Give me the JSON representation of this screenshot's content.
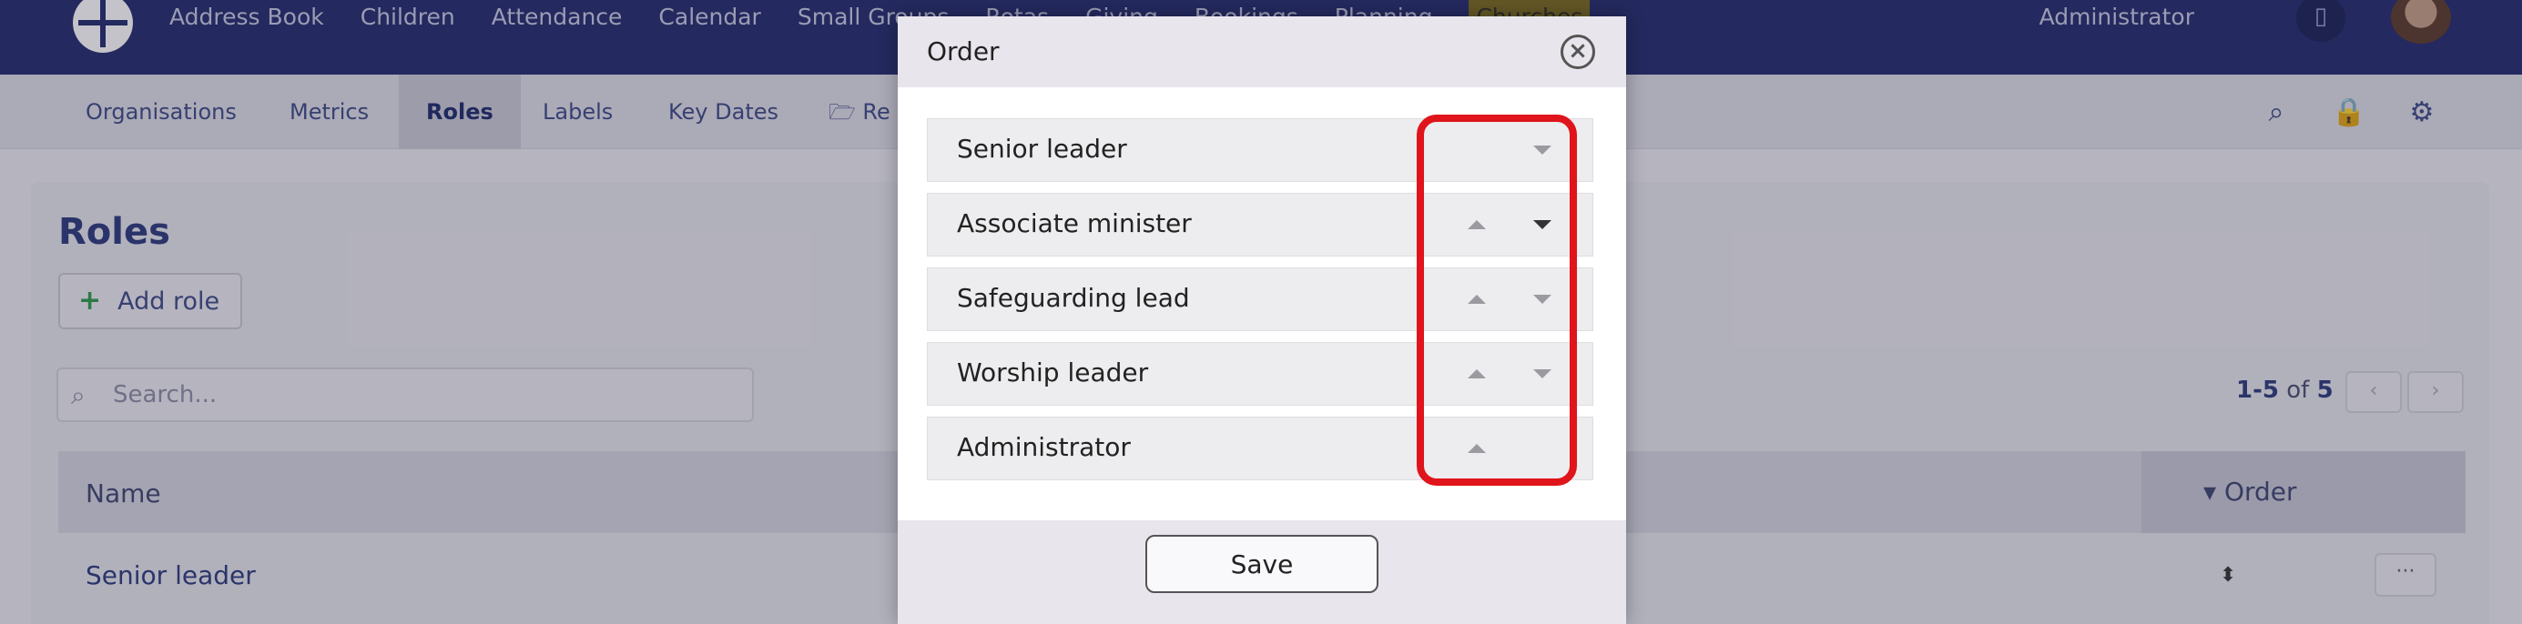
{
  "topnav": {
    "items": [
      "Address Book",
      "Children",
      "Attendance",
      "Calendar",
      "Small Groups",
      "Rotas",
      "Giving",
      "Bookings",
      "Planning",
      "Churches"
    ],
    "user_label": "Administrator"
  },
  "subnav": {
    "tabs": [
      "Organisations",
      "Metrics",
      "Roles",
      "Labels",
      "Key Dates",
      "Re"
    ],
    "active_tab": "Roles"
  },
  "page": {
    "title": "Roles",
    "add_button": "Add role",
    "search_placeholder": "Search...",
    "pagination": {
      "range": "1-5",
      "of_label": "of",
      "total": "5"
    },
    "columns": {
      "name": "Name",
      "order": "Order"
    },
    "rows": [
      {
        "name": "Senior leader"
      }
    ]
  },
  "modal": {
    "title": "Order",
    "items": [
      {
        "label": "Senior leader",
        "can_up": false,
        "can_down": true
      },
      {
        "label": "Associate minister",
        "can_up": true,
        "can_down": true
      },
      {
        "label": "Safeguarding lead",
        "can_up": true,
        "can_down": true
      },
      {
        "label": "Worship leader",
        "can_up": true,
        "can_down": true
      },
      {
        "label": "Administrator",
        "can_up": true,
        "can_down": false
      }
    ],
    "save_label": "Save"
  },
  "colors": {
    "nav_bg": "#232a6c",
    "highlight": "#e0141b",
    "add_icon": "#2e9a4a"
  },
  "icons": {
    "logo": "cross-logo-icon",
    "building": "building-icon",
    "search": "search-icon",
    "lock": "lock-icon",
    "settings": "gears-icon",
    "close": "close-circle-icon",
    "up": "caret-up-icon",
    "down": "caret-down-icon"
  }
}
